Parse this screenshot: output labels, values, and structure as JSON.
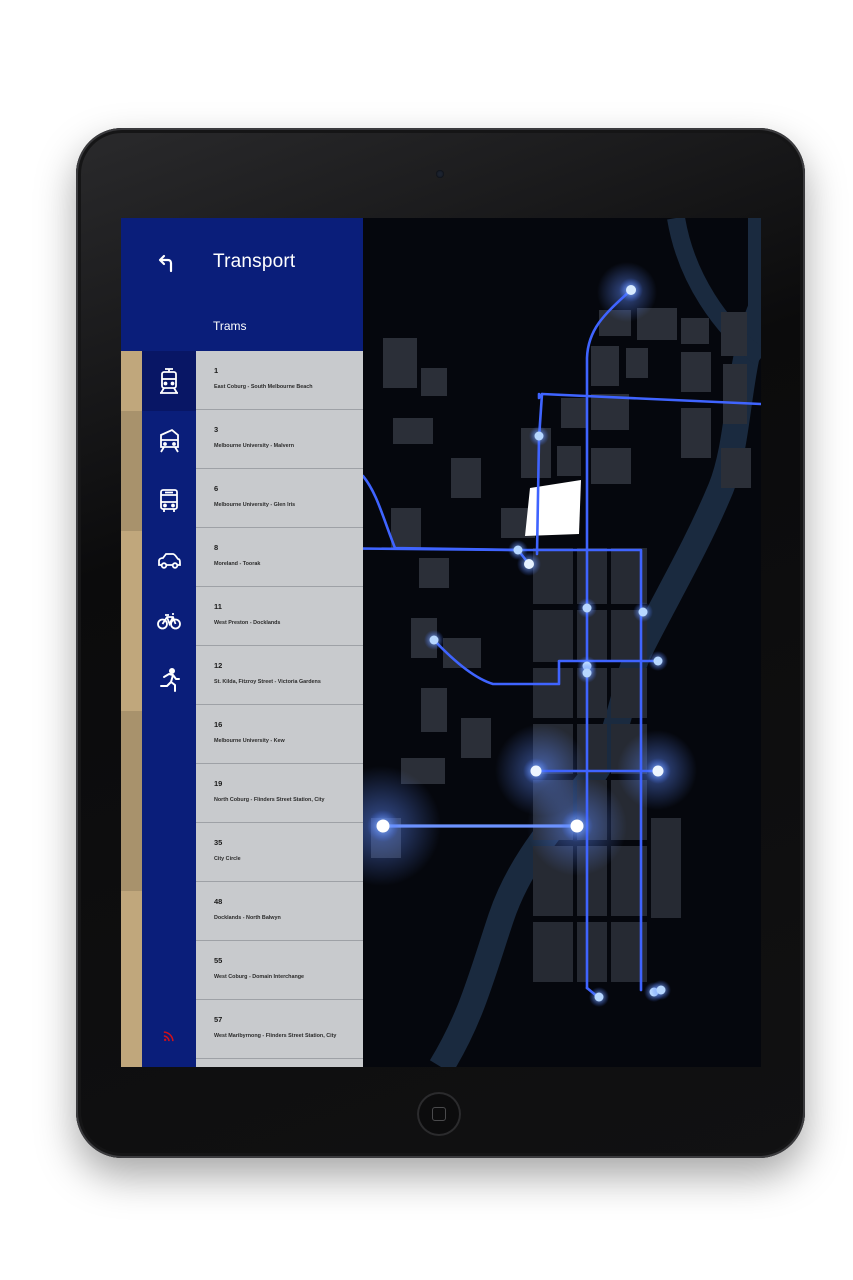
{
  "header": {
    "title": "Transport",
    "subtitle": "Trams"
  },
  "modes": [
    {
      "name": "tram",
      "icon": "tram-icon",
      "active": true
    },
    {
      "name": "train",
      "icon": "train-icon",
      "active": false
    },
    {
      "name": "bus",
      "icon": "bus-icon",
      "active": false
    },
    {
      "name": "car",
      "icon": "car-icon",
      "active": false
    },
    {
      "name": "bike",
      "icon": "bike-icon",
      "active": false
    },
    {
      "name": "walk",
      "icon": "walk-icon",
      "active": false
    }
  ],
  "routes": [
    {
      "number": "1",
      "name": "East Coburg - South Melbourne Beach"
    },
    {
      "number": "3",
      "name": "Melbourne University - Malvern"
    },
    {
      "number": "6",
      "name": "Melbourne University - Glen Iris"
    },
    {
      "number": "8",
      "name": "Moreland - Toorak"
    },
    {
      "number": "11",
      "name": "West Preston - Docklands"
    },
    {
      "number": "12",
      "name": "St. Kilda, Fitzroy Street - Victoria Gardens"
    },
    {
      "number": "16",
      "name": "Melbourne University - Kew"
    },
    {
      "number": "19",
      "name": "North Coburg - Flinders Street Station, City"
    },
    {
      "number": "35",
      "name": "City Circle"
    },
    {
      "number": "48",
      "name": "Docklands - North Balwyn"
    },
    {
      "number": "55",
      "name": "West Coburg - Domain Interchange"
    },
    {
      "number": "57",
      "name": "West Maribyrnong - Flinders Street Station, City"
    }
  ],
  "colors": {
    "nav_blue": "#0a1e7a",
    "accent_tan": "#c0a77c",
    "list_gray": "#c8cacd",
    "live_red": "#d0101a",
    "route_glow": "#6aa8ff"
  }
}
